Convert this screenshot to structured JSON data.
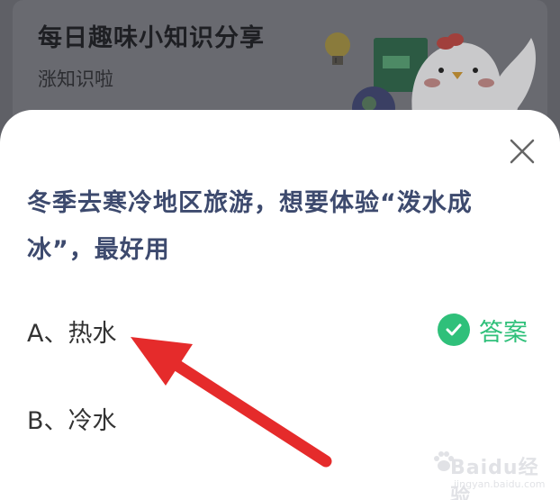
{
  "banner": {
    "title": "每日趣味小知识分享",
    "subtitle": "涨知识啦"
  },
  "quiz": {
    "question": "冬季去寒冷地区旅游，想要体验“泼水成冰”，最好用",
    "options": [
      {
        "label": "A、热水"
      },
      {
        "label": "B、冷水"
      }
    ],
    "answer_label": "答案",
    "correct_option": "A"
  },
  "colors": {
    "overlay": "#5f6066",
    "question_text": "#3d4a6e",
    "answer_green": "#2fc07a",
    "arrow_red": "#e52b2b"
  },
  "icons": [
    "close-icon",
    "check-icon",
    "red-arrow",
    "lightbulb-icon",
    "chicken-mascot"
  ],
  "watermark": {
    "text": "Baidu经验",
    "url": "jingyan.baidu.com"
  }
}
